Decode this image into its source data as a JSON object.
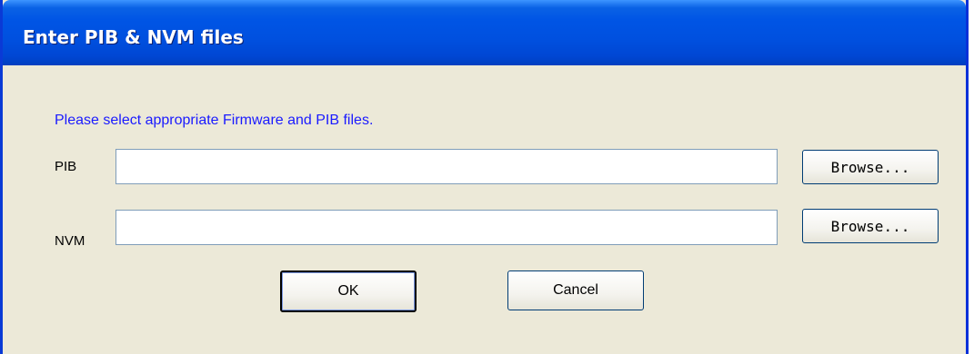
{
  "window": {
    "title": "Enter PIB & NVM files"
  },
  "dialog": {
    "prompt": "Please select appropriate Firmware and PIB files.",
    "pib": {
      "label": "PIB",
      "value": "",
      "browse_label": "Browse..."
    },
    "nvm": {
      "label": "NVM",
      "value": "",
      "browse_label": "Browse..."
    },
    "ok_label": "OK",
    "cancel_label": "Cancel"
  }
}
